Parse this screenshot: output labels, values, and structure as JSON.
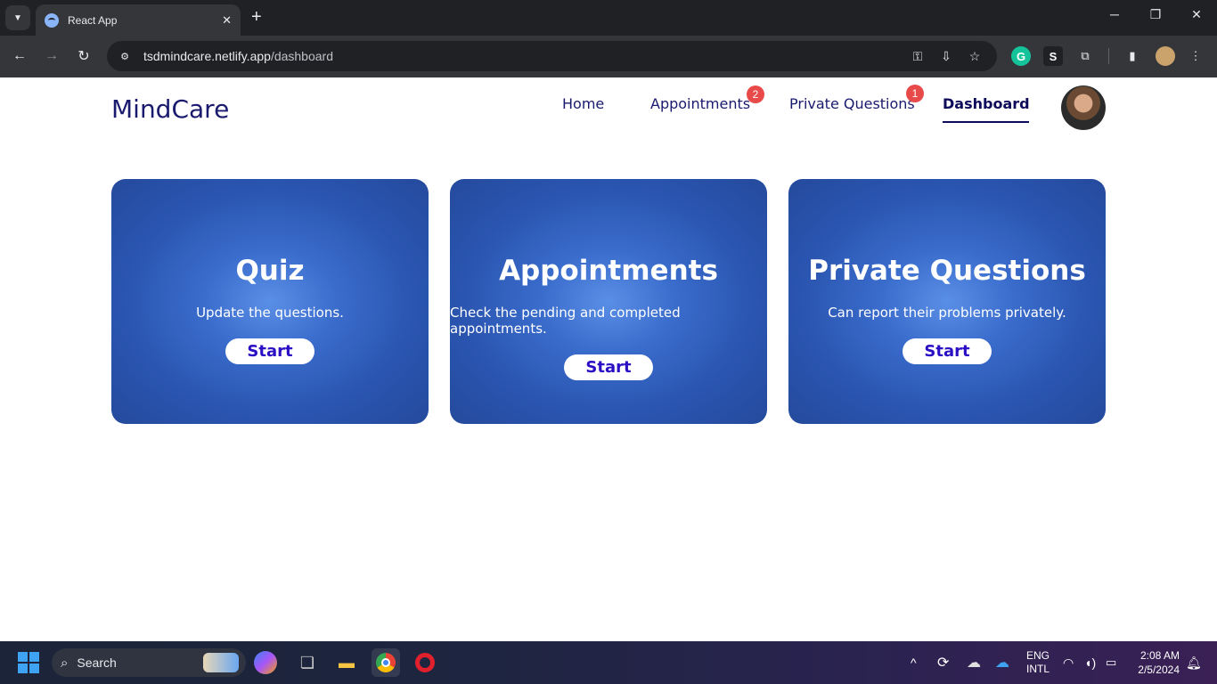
{
  "browser": {
    "tab_title": "React App",
    "url_host": "tsdmindcare.netlify.app",
    "url_path": "/dashboard",
    "close_tab": "✕",
    "new_tab": "+",
    "minimize": "─",
    "restore": "❐",
    "close_window": "✕",
    "back": "←",
    "forward": "→",
    "reload": "↻"
  },
  "site": {
    "brand": "MindCare",
    "nav": [
      {
        "label": "Home"
      },
      {
        "label": "Appointments",
        "badge": "2"
      },
      {
        "label": "Private Questions",
        "badge": "1"
      },
      {
        "label": "Dashboard"
      }
    ]
  },
  "cards": [
    {
      "title": "Quiz",
      "description": "Update the questions.",
      "button": "Start"
    },
    {
      "title": "Appointments",
      "description": "Check the pending and completed appointments.",
      "button": "Start"
    },
    {
      "title": "Private Questions",
      "description": "Can report their problems privately.",
      "button": "Start"
    }
  ],
  "taskbar": {
    "search_placeholder": "Search",
    "lang_top": "ENG",
    "lang_bottom": "INTL",
    "time": "2:08 AM",
    "date": "2/5/2024"
  },
  "colors": {
    "brand": "#1a1a6e",
    "card_blue": "#2a55b0",
    "badge_red": "#e84a4a",
    "start_text": "#2a0fc4"
  }
}
